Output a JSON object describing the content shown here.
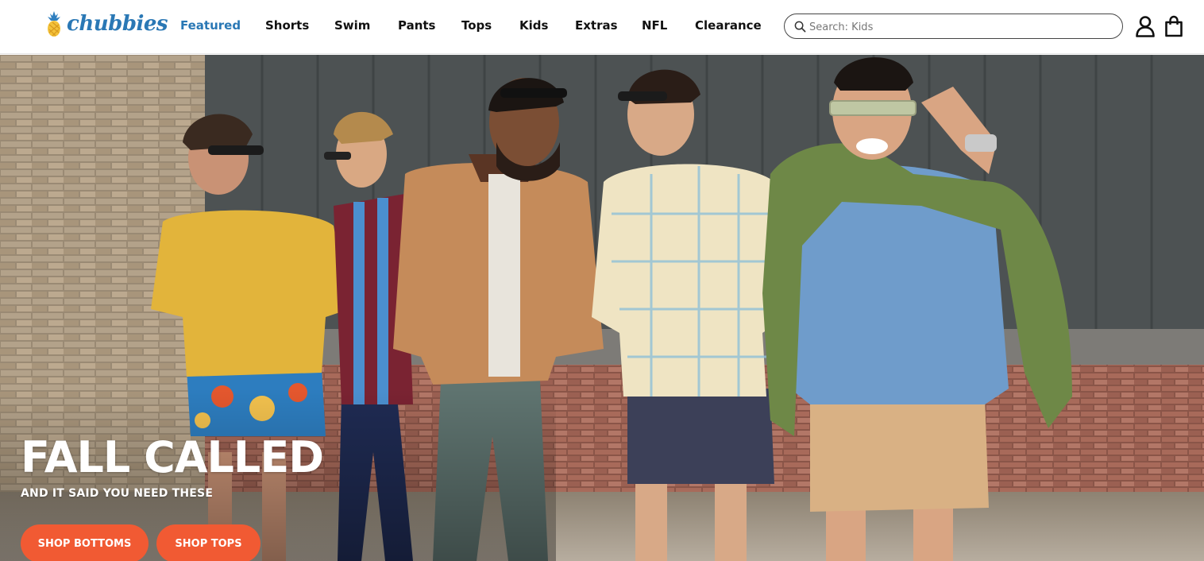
{
  "brand": {
    "name": "chubbies",
    "accent_color": "#2a78b5",
    "cta_color": "#f15a33"
  },
  "nav": {
    "items": [
      {
        "label": "Featured",
        "active": true
      },
      {
        "label": "Shorts",
        "active": false
      },
      {
        "label": "Swim",
        "active": false
      },
      {
        "label": "Pants",
        "active": false
      },
      {
        "label": "Tops",
        "active": false
      },
      {
        "label": "Kids",
        "active": false
      },
      {
        "label": "Extras",
        "active": false
      },
      {
        "label": "NFL",
        "active": false
      },
      {
        "label": "Clearance",
        "active": false
      }
    ]
  },
  "search": {
    "placeholder": "Search: Kids",
    "value": "",
    "icon": "search-icon"
  },
  "header_icons": {
    "account": "account-icon",
    "bag": "shopping-bag-icon"
  },
  "hero": {
    "headline": "FALL CALLED",
    "subline": "AND IT SAID YOU NEED THESE",
    "cta_primary": "SHOP BOTTOMS",
    "cta_secondary": "SHOP TOPS"
  }
}
